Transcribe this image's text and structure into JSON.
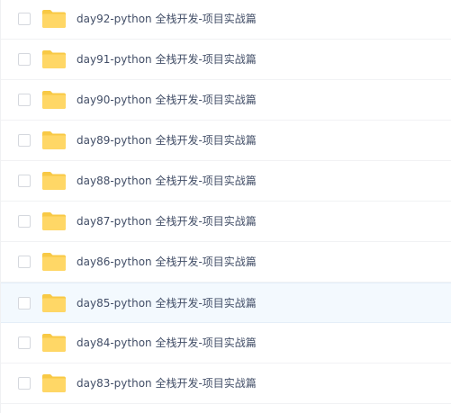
{
  "colors": {
    "folder_back": "#f8c945",
    "folder_front": "#ffd766",
    "text": "#424e67",
    "hover_row": "#f3f9fe",
    "checkbox_border": "#d5d8de"
  },
  "file_list": {
    "hovered_index": 7,
    "rows": [
      {
        "name": "day92-python 全栈开发-项目实战篇",
        "icon": "folder-icon",
        "checked": false
      },
      {
        "name": "day91-python 全栈开发-项目实战篇",
        "icon": "folder-icon",
        "checked": false
      },
      {
        "name": "day90-python 全栈开发-项目实战篇",
        "icon": "folder-icon",
        "checked": false
      },
      {
        "name": "day89-python 全栈开发-项目实战篇",
        "icon": "folder-icon",
        "checked": false
      },
      {
        "name": "day88-python 全栈开发-项目实战篇",
        "icon": "folder-icon",
        "checked": false
      },
      {
        "name": "day87-python 全栈开发-项目实战篇",
        "icon": "folder-icon",
        "checked": false
      },
      {
        "name": "day86-python 全栈开发-项目实战篇",
        "icon": "folder-icon",
        "checked": false
      },
      {
        "name": "day85-python 全栈开发-项目实战篇",
        "icon": "folder-icon",
        "checked": false
      },
      {
        "name": "day84-python 全栈开发-项目实战篇",
        "icon": "folder-icon",
        "checked": false
      },
      {
        "name": "day83-python 全栈开发-项目实战篇",
        "icon": "folder-icon",
        "checked": false
      }
    ]
  }
}
